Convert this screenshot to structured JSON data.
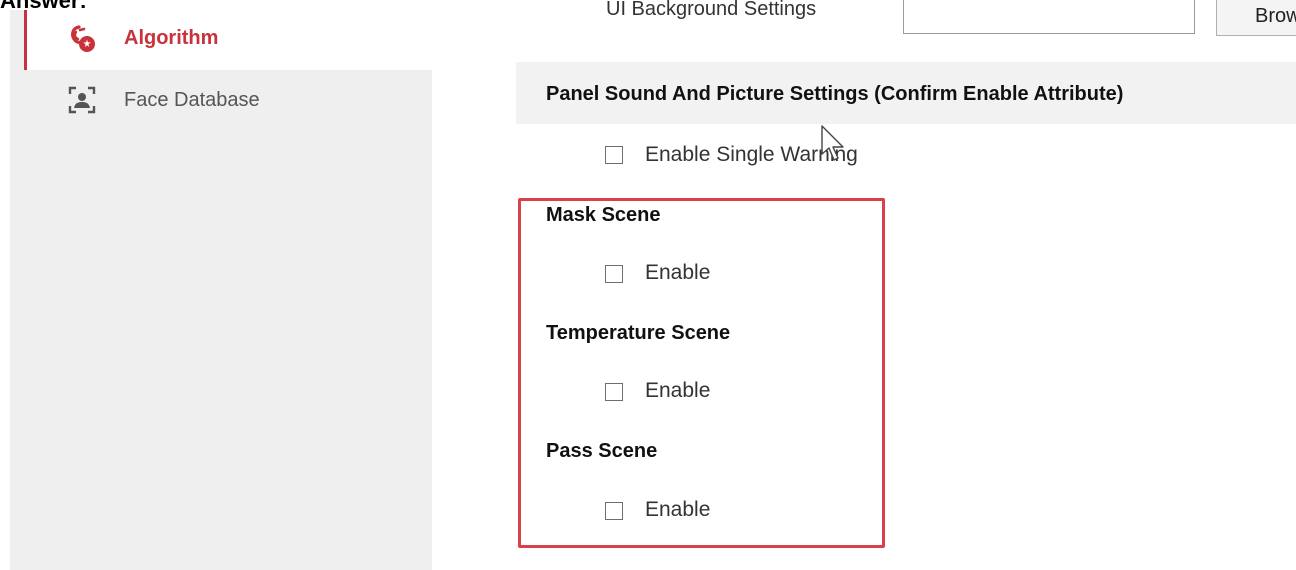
{
  "top_caption": "Answer:",
  "sidebar": {
    "items": [
      {
        "label": "Algorithm",
        "icon": "algorithm-icon",
        "active": true
      },
      {
        "label": "Face Database",
        "icon": "face-database-icon",
        "active": false
      }
    ]
  },
  "ui_background": {
    "label": "UI Background Settings",
    "input_value": "",
    "browse_label": "Browse"
  },
  "panel": {
    "title": "Panel Sound And Picture Settings (Confirm Enable Attribute)",
    "single_warning_label": "Enable Single Warning",
    "single_warning_checked": false
  },
  "scenes": [
    {
      "title": "Mask Scene",
      "enable_label": "Enable",
      "checked": false
    },
    {
      "title": "Temperature Scene",
      "enable_label": "Enable",
      "checked": false
    },
    {
      "title": "Pass Scene",
      "enable_label": "Enable",
      "checked": false
    }
  ],
  "colors": {
    "accent": "#c8333b",
    "highlight_border": "#d9414a",
    "sidebar_bg": "#efefef",
    "panel_header_bg": "#f2f2f2"
  }
}
